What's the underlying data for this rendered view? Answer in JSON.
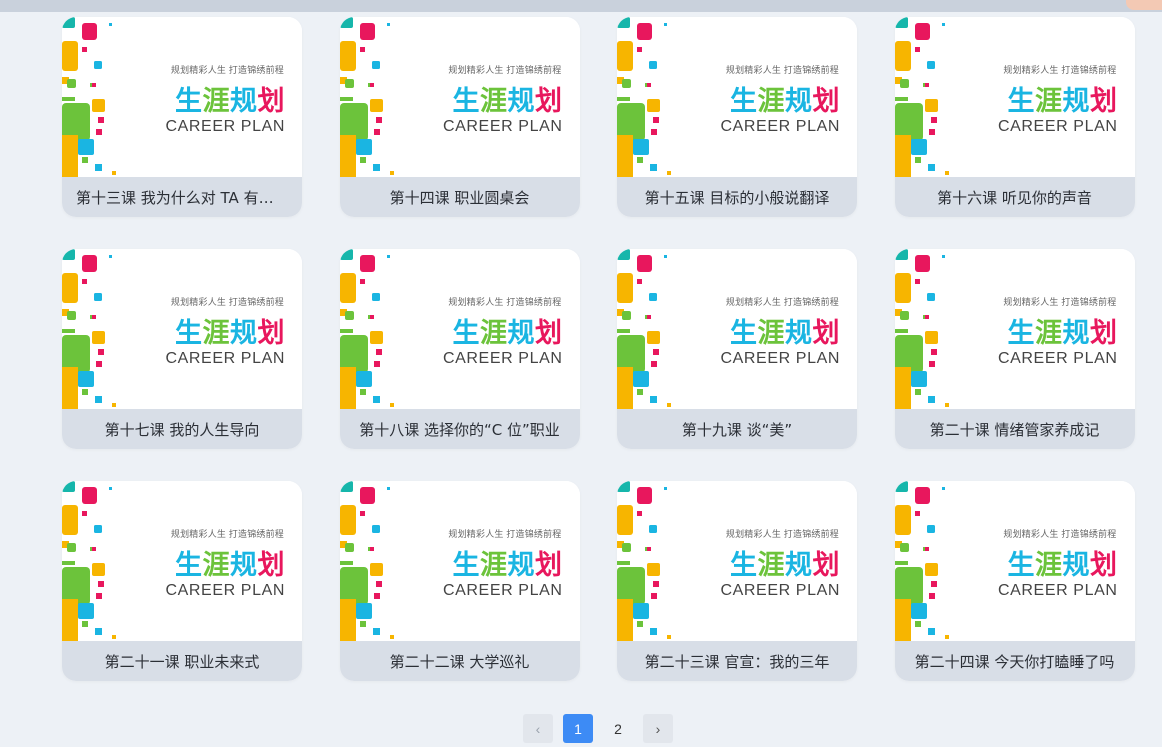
{
  "poster": {
    "tagline": "规划精彩人生   打造锦绣前程",
    "cn_title": [
      "生",
      "涯",
      "规",
      "划"
    ],
    "en_title": "CAREER PLAN"
  },
  "courses": [
    {
      "title": "第十三课 我为什么对 TA 有好感"
    },
    {
      "title": "第十四课 职业圆桌会"
    },
    {
      "title": "第十五课 目标的小般说翻译"
    },
    {
      "title": "第十六课 听见你的声音"
    },
    {
      "title": "第十七课 我的人生导向"
    },
    {
      "title": "第十八课 选择你的“C 位”职业"
    },
    {
      "title": "第十九课 谈“美”"
    },
    {
      "title": "第二十课 情绪管家养成记"
    },
    {
      "title": "第二十一课 职业未来式"
    },
    {
      "title": "第二十二课 大学巡礼"
    },
    {
      "title": "第二十三课 官宣：我的三年"
    },
    {
      "title": "第二十四课 今天你打瞌睡了吗"
    }
  ],
  "pagination": {
    "prev_icon": "‹",
    "next_icon": "›",
    "pages": [
      "1",
      "2"
    ],
    "current": "1"
  },
  "colors": {
    "accent": "#3d8bf5",
    "caption_bg": "#d8dee7",
    "page_bg": "#edf1f6"
  }
}
